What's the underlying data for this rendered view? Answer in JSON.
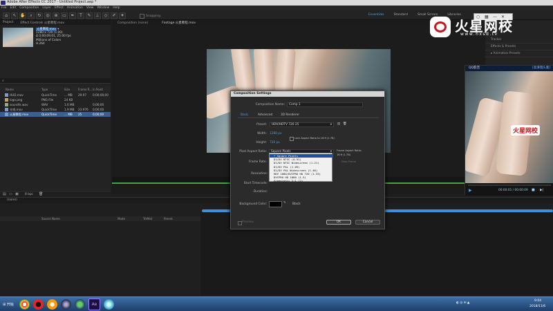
{
  "window": {
    "title": "Adobe After Effects CC 2017 - Untitled Project.aep *"
  },
  "menu": [
    "File",
    "Edit",
    "Composition",
    "Layer",
    "Effect",
    "Animation",
    "View",
    "Window",
    "Help"
  ],
  "workspaces": {
    "items": [
      "Essentials",
      "Standard",
      "Small Screen",
      "Libraries"
    ],
    "active": "Essentials"
  },
  "toolbar": {
    "snapping_label": "Snapping"
  },
  "project": {
    "tab_project": "Project",
    "tab_effect": "Effect Controls 火星教程.mov",
    "selected_name": "火星教程.mov",
    "meta": [
      "1280 x 720 (1.00)",
      "Δ 0;00;09;01, 25.00 fps",
      "Millions of Colors",
      "H.264"
    ],
    "columns": {
      "name": "Name",
      "type": "Type",
      "size": "Size",
      "frame_rate": "Frame R...",
      "in_point": "In Point"
    },
    "files": [
      {
        "name": "HUD.mov",
        "type": "QuickTime",
        "size": "... MB",
        "rate": "29.97",
        "in": "0;00;00;00"
      },
      {
        "name": "logo.png",
        "type": "PNG File",
        "size": "24 KB",
        "rate": "",
        "in": ""
      },
      {
        "name": "soundfx.wav",
        "type": "WAV",
        "size": "1.6 MB",
        "rate": "",
        "in": "0;00;00"
      },
      {
        "name": "光线.mov",
        "type": "QuickTime",
        "size": "1.9 MB",
        "rate": "23.976",
        "in": "0;00;00"
      },
      {
        "name": "火星教程.mov",
        "type": "QuickTime",
        "size": "... MB",
        "rate": "25",
        "in": "0;00;00"
      }
    ],
    "bpc": "8 bpc"
  },
  "viewer": {
    "tab_comp": "Composition (none)",
    "tab_footage": "Footage 火星教程.mov"
  },
  "right_panels": [
    "Tracker",
    "Effects & Presets",
    "▸ Animation Presets"
  ],
  "qq_player": {
    "title": "QQ影音",
    "right_text": "[高清镜头素]",
    "time": "00:00:01 / 00:00:09"
  },
  "brand": {
    "name": "火星网校",
    "url": "www.hxsd.tv"
  },
  "timeline": {
    "tab": "(none)",
    "columns": {
      "source": "Source Name",
      "mode": "Mode",
      "trkmat": "TrkMat",
      "parent": "Parent"
    }
  },
  "dialog": {
    "title": "Composition Settings",
    "comp_name_label": "Composition Name:",
    "comp_name": "Comp 1",
    "tabs": [
      "Basic",
      "Advanced",
      "3D Renderer"
    ],
    "preset_label": "Preset:",
    "preset_value": "HDV/HDTV 720 25",
    "width_label": "Width:",
    "width_value": "1280 px",
    "height_label": "Height:",
    "height_value": "720 px",
    "lock_label": "Lock Aspect Ratio to 16:9 (1.78)",
    "par_label": "Pixel Aspect Ratio:",
    "par_value": "Square Pixels",
    "frame_aspect_label": "Frame Aspect Ratio:",
    "frame_aspect_value": "16:9 (1.78)",
    "frame_rate_label": "Frame Rate:",
    "drop_frame_label": "Drop Frame",
    "resolution_label": "Resolution:",
    "start_tc_label": "Start Timecode:",
    "duration_label": "Duration:",
    "bg_color_label": "Background Color:",
    "bg_color_name": "Black",
    "preview_label": "Preview",
    "ok": "OK",
    "cancel": "Cancel",
    "par_options": [
      "Square Pixels",
      "D1/DV NTSC (0.91)",
      "D1/DV NTSC Widescreen (1.21)",
      "D1/DV PAL (1.09)",
      "D1/DV PAL Widescreen (1.46)",
      "HDV 1080/DVCPRO HD 720 (1.33)",
      "DVCPRO HD 1080 (1.5)",
      "Anamorphic 2:1 (2)"
    ]
  },
  "taskbar": {
    "start": "开始",
    "time": "9:04",
    "date": "2018/11/6"
  },
  "colors": {
    "accent": "#4aa0e8",
    "dialog_highlight": "#1c4f9c",
    "timeline_green": "#3fa64a",
    "brand_red": "#c8161d"
  }
}
